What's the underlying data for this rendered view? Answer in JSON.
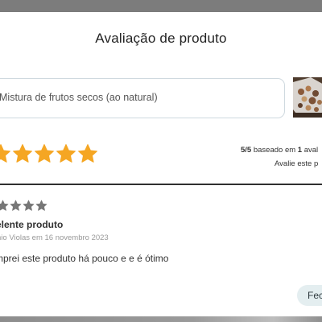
{
  "modal": {
    "title": "Avaliação de produto"
  },
  "product": {
    "name": "Mistura de frutos secos (ao natural)",
    "thumbnail_icon": "product-photo"
  },
  "rating": {
    "stars_filled": 5,
    "stars_total": 5,
    "star_color": "#f5a623",
    "summary_score": "5/5",
    "summary_text_a": "baseado em",
    "summary_count": "1",
    "summary_text_b": "aval",
    "rate_link": "Avalie este p"
  },
  "review": {
    "stars_filled": 4,
    "star_color": "#777777",
    "title": "elente produto",
    "meta": "nio Violas em 16 novembro 2023",
    "body": "mprei este produto há pouco e e é ótimo"
  },
  "actions": {
    "button_label": "Fec"
  },
  "colors": {
    "divider": "#2f2f2f",
    "button_bg": "#e4eef0",
    "input_border": "#cfd9df"
  }
}
